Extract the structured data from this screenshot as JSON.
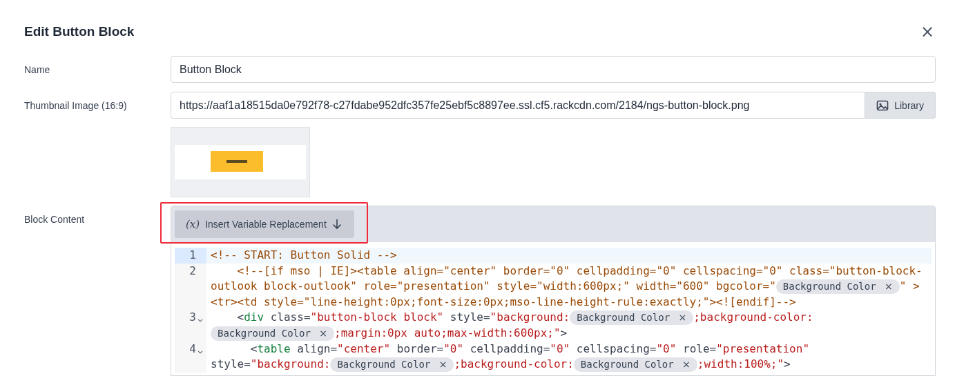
{
  "dialog": {
    "title": "Edit Button Block",
    "close": "×"
  },
  "fields": [
    {
      "label": "Name",
      "value": "Button Block"
    },
    {
      "label": "Thumbnail Image (16:9)",
      "value": "https://aaf1a18515da0e792f78-c27fdabe952dfc357fe25ebf5c8897ee.ssl.cf5.rackcdn.com/2184/ngs-button-block.png",
      "button": "Library"
    }
  ],
  "block_content": {
    "label": "Block Content",
    "toolbar_button": {
      "icon": "(x)",
      "label": "Insert Variable Replacement",
      "highlighted": true
    },
    "lines": [
      {
        "number": "1",
        "active": true,
        "foldable": false,
        "segments": [
          {
            "kind": "comment",
            "text": "<!-- START: Button Solid -->"
          }
        ]
      },
      {
        "number": "2",
        "active": false,
        "foldable": false,
        "segments": [
          {
            "kind": "comment",
            "text": "    <!--[if mso | IE]><table align=\"center\" border=\"0\" cellpadding=\"0\" cellspacing=\"0\" class=\"button-block-"
          },
          {
            "kind": "wrap"
          },
          {
            "kind": "comment",
            "text": "outlook block-outlook\" role=\"presentation\" style=\"width:600px;\" width=\"600\" bgcolor=\""
          },
          {
            "kind": "chip",
            "text": "Background Color",
            "remove": "×"
          },
          {
            "kind": "comment",
            "text": "\" >"
          },
          {
            "kind": "wrap"
          },
          {
            "kind": "comment",
            "text": "<tr><td style=\"line-height:0px;font-size:0px;mso-line-height-rule:exactly;\"><![endif]-->"
          }
        ]
      },
      {
        "number": "3",
        "active": false,
        "foldable": true,
        "segments": [
          {
            "kind": "punct",
            "text": "    <"
          },
          {
            "kind": "tag",
            "text": "div"
          },
          {
            "kind": "attr",
            "text": " class="
          },
          {
            "kind": "string",
            "text": "\"button-block block\""
          },
          {
            "kind": "attr",
            "text": " style="
          },
          {
            "kind": "string",
            "text": "\"background:"
          },
          {
            "kind": "chip",
            "text": "Background Color",
            "remove": "×"
          },
          {
            "kind": "string",
            "text": ";background-color:"
          },
          {
            "kind": "wrap"
          },
          {
            "kind": "chip",
            "text": "Background Color",
            "remove": "×"
          },
          {
            "kind": "string",
            "text": ";margin:0px auto;max-width:600px;\""
          },
          {
            "kind": "punct",
            "text": ">"
          }
        ]
      },
      {
        "number": "4",
        "active": false,
        "foldable": true,
        "segments": [
          {
            "kind": "punct",
            "text": "      <"
          },
          {
            "kind": "tag",
            "text": "table"
          },
          {
            "kind": "attr",
            "text": " align="
          },
          {
            "kind": "string",
            "text": "\"center\""
          },
          {
            "kind": "attr",
            "text": " border="
          },
          {
            "kind": "string",
            "text": "\"0\""
          },
          {
            "kind": "attr",
            "text": " cellpadding="
          },
          {
            "kind": "string",
            "text": "\"0\""
          },
          {
            "kind": "attr",
            "text": " cellspacing="
          },
          {
            "kind": "string",
            "text": "\"0\""
          },
          {
            "kind": "attr",
            "text": " role="
          },
          {
            "kind": "string",
            "text": "\"presentation\""
          },
          {
            "kind": "wrap"
          },
          {
            "kind": "attr",
            "text": "style="
          },
          {
            "kind": "string",
            "text": "\"background:"
          },
          {
            "kind": "chip",
            "text": "Background Color",
            "remove": "×"
          },
          {
            "kind": "string",
            "text": ";background-color:"
          },
          {
            "kind": "chip",
            "text": "Background Color",
            "remove": "×"
          },
          {
            "kind": "string",
            "text": ";width:100%;\""
          },
          {
            "kind": "punct",
            "text": ">"
          }
        ]
      }
    ]
  }
}
